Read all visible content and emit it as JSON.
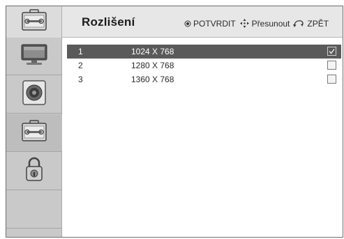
{
  "header": {
    "title": "Rozlišení",
    "hints": {
      "confirm_label": "POTVRDIT",
      "move_label": "Přesunout",
      "back_label": "ZPĚT"
    },
    "icon": "toolbox-icon"
  },
  "sidebar": {
    "items": [
      {
        "icon": "monitor-icon",
        "active": false
      },
      {
        "icon": "speaker-icon",
        "active": false
      },
      {
        "icon": "toolbox-icon",
        "active": true
      },
      {
        "icon": "padlock-icon",
        "active": false
      },
      {
        "icon": "",
        "active": false
      }
    ]
  },
  "resolutions": [
    {
      "number": "1",
      "value": "1024 X 768",
      "checked": true,
      "selected": true
    },
    {
      "number": "2",
      "value": "1280 X 768",
      "checked": false,
      "selected": false
    },
    {
      "number": "3",
      "value": "1360 X 768",
      "checked": false,
      "selected": false
    }
  ],
  "checkmark": "✓",
  "colors": {
    "selected_row": "#5a5a5a",
    "sidebar": "#c9c9c9",
    "header": "#e7e7e7"
  }
}
